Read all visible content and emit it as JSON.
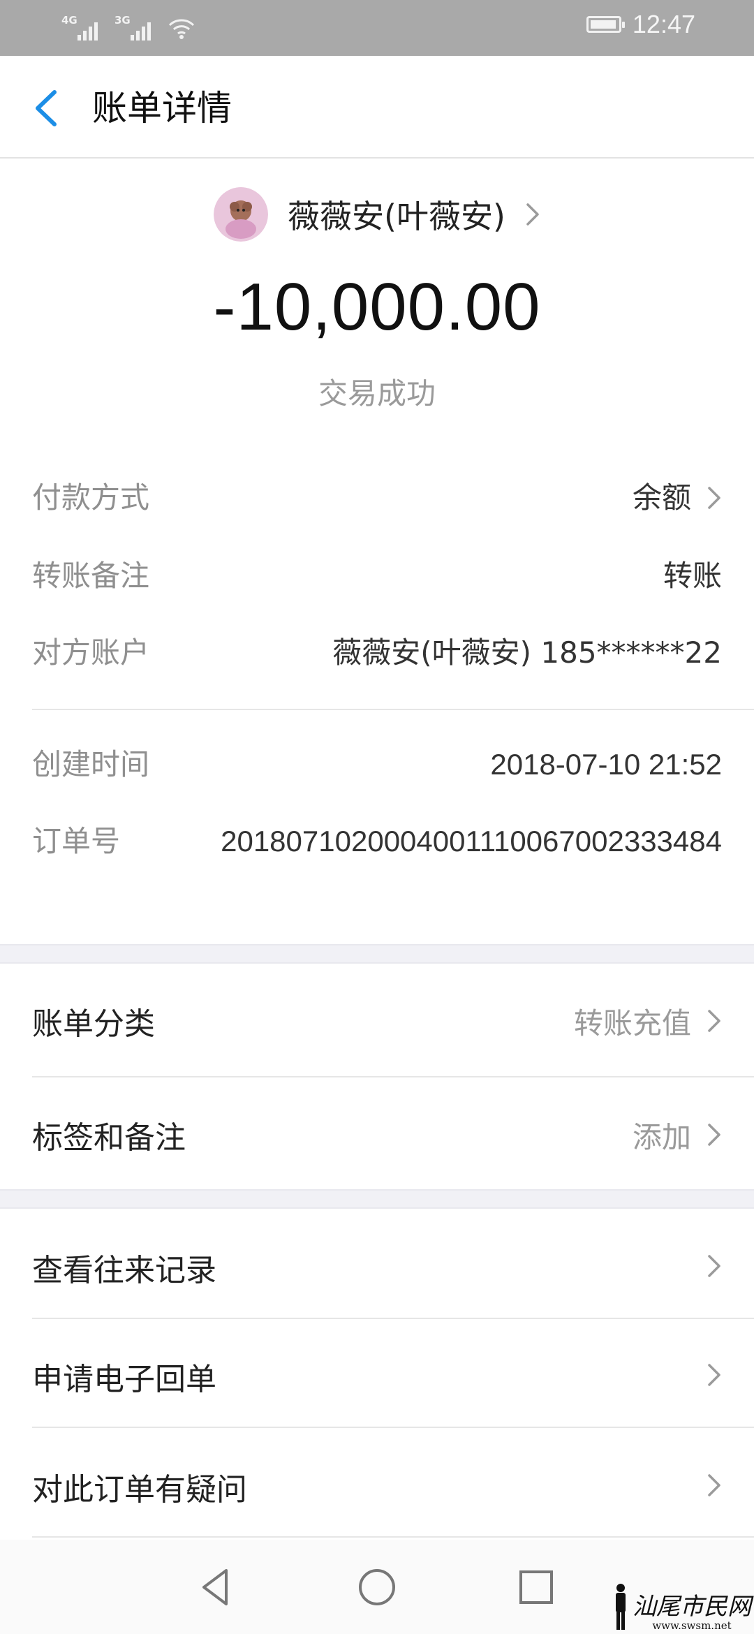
{
  "status_bar": {
    "signal1_label": "4G",
    "signal2_label": "3G",
    "time": "12:47"
  },
  "header": {
    "title": "账单详情"
  },
  "summary": {
    "payee_name": "薇薇安(叶薇安)",
    "amount": "-10,000.00",
    "status": "交易成功"
  },
  "details": {
    "payment_method": {
      "label": "付款方式",
      "value": "余额"
    },
    "transfer_note": {
      "label": "转账备注",
      "value": "转账"
    },
    "counterparty": {
      "label": "对方账户",
      "value": "薇薇安(叶薇安) 185******22"
    },
    "created_time": {
      "label": "创建时间",
      "value": "2018-07-10 21:52"
    },
    "order_no": {
      "label": "订单号",
      "value": "2018071020004001110067002333484"
    }
  },
  "menu": {
    "category": {
      "label": "账单分类",
      "value": "转账充值"
    },
    "tags": {
      "label": "标签和备注",
      "value": "添加"
    },
    "history": {
      "label": "查看往来记录"
    },
    "receipt": {
      "label": "申请电子回单"
    },
    "question": {
      "label": "对此订单有疑问"
    }
  },
  "watermark": {
    "line1": "汕尾市民网",
    "line2": "www.swsm.net"
  },
  "colors": {
    "accent": "#1c8ee6",
    "status_bar": "#a9a9a9",
    "label_gray": "#8f8f8f",
    "separator": "#f1f1f6"
  }
}
